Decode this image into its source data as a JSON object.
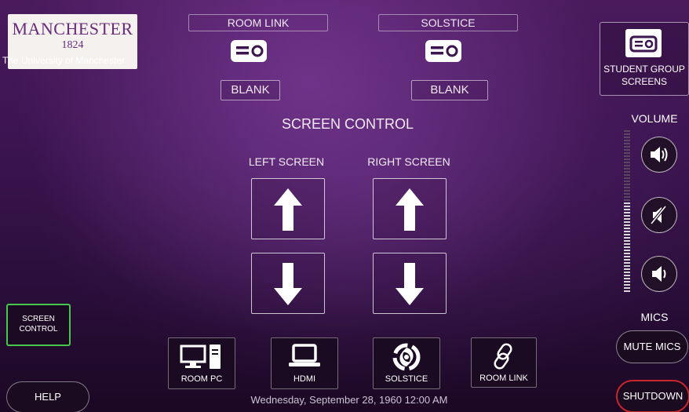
{
  "logo": {
    "wordmark": "MANCHESTER",
    "year": "1824",
    "university": "The University of Manchester"
  },
  "header": {
    "room_link_label": "ROOM LINK",
    "solstice_label": "SOLSTICE",
    "room_link_blank": "BLANK",
    "solstice_blank": "BLANK",
    "projector_icon": "projector-icon"
  },
  "student_group": {
    "label_line1": "STUDENT GROUP",
    "label_line2": "SCREENS",
    "icon": "projector-icon"
  },
  "screen_control": {
    "title": "SCREEN CONTROL",
    "left_label": "LEFT SCREEN",
    "right_label": "RIGHT SCREEN"
  },
  "volume": {
    "label": "VOLUME",
    "level_percent": 55
  },
  "mics": {
    "label": "MICS",
    "mute_label": "MUTE MICS"
  },
  "left_panel": {
    "screen_control_line1": "SCREEN",
    "screen_control_line2": "CONTROL",
    "help_label": "HELP"
  },
  "sources": [
    {
      "label": "ROOM PC",
      "icon": "desktop-pc-icon",
      "active": false
    },
    {
      "label": "HDMI",
      "icon": "laptop-icon",
      "active": false
    },
    {
      "label": "SOLSTICE",
      "icon": "solstice-swirl-icon",
      "active": false
    },
    {
      "label": "ROOM LINK",
      "icon": "link-icon",
      "active": true
    }
  ],
  "footer": {
    "datetime": "Wednesday, September 28, 1960 12:00 AM",
    "shutdown_label": "SHUTDOWN"
  },
  "colors": {
    "accent_green": "#45c84a",
    "shutdown_red": "#c8252c",
    "brand_purple": "#6a2b7a"
  }
}
